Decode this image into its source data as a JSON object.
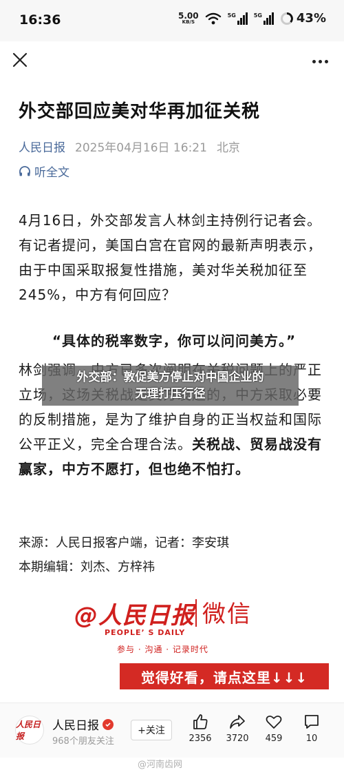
{
  "status": {
    "time": "16:36",
    "speed_value": "5.00",
    "speed_unit": "KB/S",
    "network_label_1": "5G",
    "network_label_2": "5G",
    "battery": "43%"
  },
  "article": {
    "title": "外交部回应美对华再加征关税",
    "source": "人民日报",
    "time": "2025年04月16日 16:21",
    "location": "北京",
    "listen_label": "听全文",
    "paragraph1": "4月16日，外交部发言人林剑主持例行记者会。有记者提问，美国白宫在官网的最新声明表示，由于中国采取报复性措施，美对华关税加征至245%，中方有何回应？",
    "quote": "“具体的税率数字，你可以问问美方。”",
    "paragraph2_normal": "林剑强调，中方已多次阐明在关税问题上的严正立场，这场关税战是美方发起的，中方采取必要的反制措施，是为了维护自身的正当权益和国际公平正义，完全合理合法。",
    "paragraph2_bold": "关税战、贸易战没有赢家，中方不愿打，但也绝不怕打。",
    "source_line": "来源：人民日报客户端，记者：李安琪",
    "editor_line": "本期编辑：刘杰、方梓祎"
  },
  "overlay": {
    "line1": "外交部：敦促美方停止对中国企业的",
    "line2": "无理打压行径"
  },
  "promo": {
    "logo_text": "@人民日报",
    "weixin": "微信",
    "daily": "PEOPLE’ S DAILY",
    "slogan": "参与 · 沟通 · 记录时代",
    "cta": "觉得好看，请点这里↓↓↓"
  },
  "bottom": {
    "avatar_text": "人民日报",
    "account_name": "人民日报",
    "followers": "968个朋友关注",
    "follow_label": "+关注",
    "likes": "2356",
    "shares": "3720",
    "favorites": "459",
    "comments": "10"
  },
  "watermark": "@河南齿网"
}
